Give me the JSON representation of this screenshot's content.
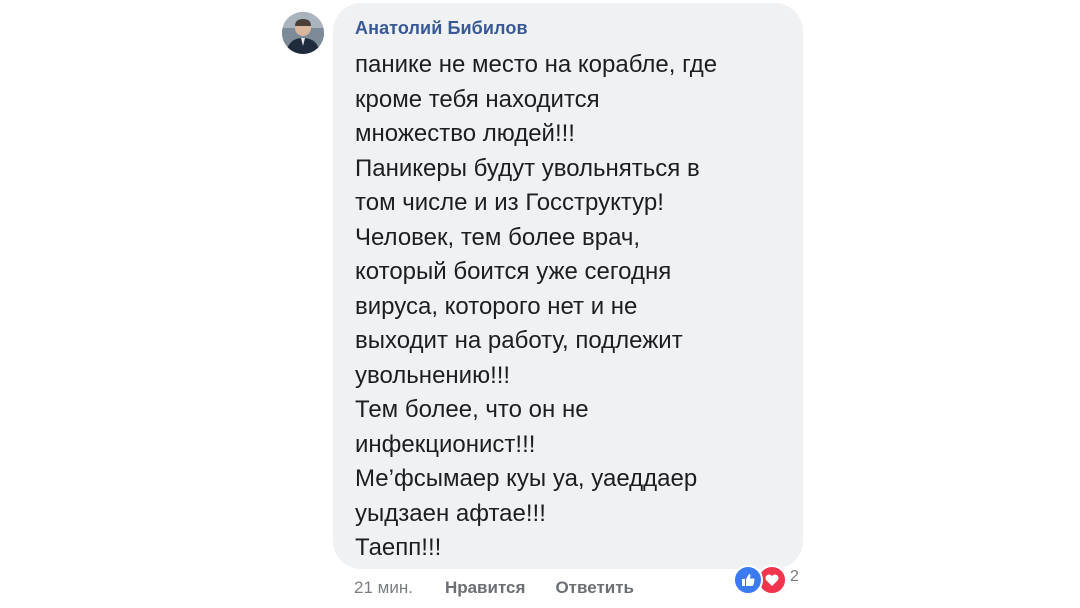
{
  "comment": {
    "author": "Анатолий Бибилов",
    "lines": [
      "панике не место на корабле, где",
      "кроме тебя находится",
      "множество людей!!!",
      "Паникеры будут увольняться в",
      "том числе и из Госструктур!",
      "Человек, тем более врач,",
      "который боится уже сегодня",
      "вируса, которого нет и не",
      "выходит на работу, подлежит",
      "увольнению!!!",
      "Тем более, что он не",
      "инфекционист!!!",
      "Ме’фсымаер куы уа, уаеддаер",
      "уыдзаен афтае!!!",
      "Таепп!!!"
    ]
  },
  "actions": {
    "time": "21 мин.",
    "like_label": "Нравится",
    "reply_label": "Ответить"
  },
  "reactions": {
    "icons": [
      "like-icon",
      "love-icon"
    ],
    "count": "2"
  },
  "colors": {
    "bubble": "#f0f1f3",
    "author": "#385898",
    "text": "#1c1e21",
    "meta": "#7a7d82",
    "like": "#3b7bf0",
    "love": "#f2344f"
  }
}
